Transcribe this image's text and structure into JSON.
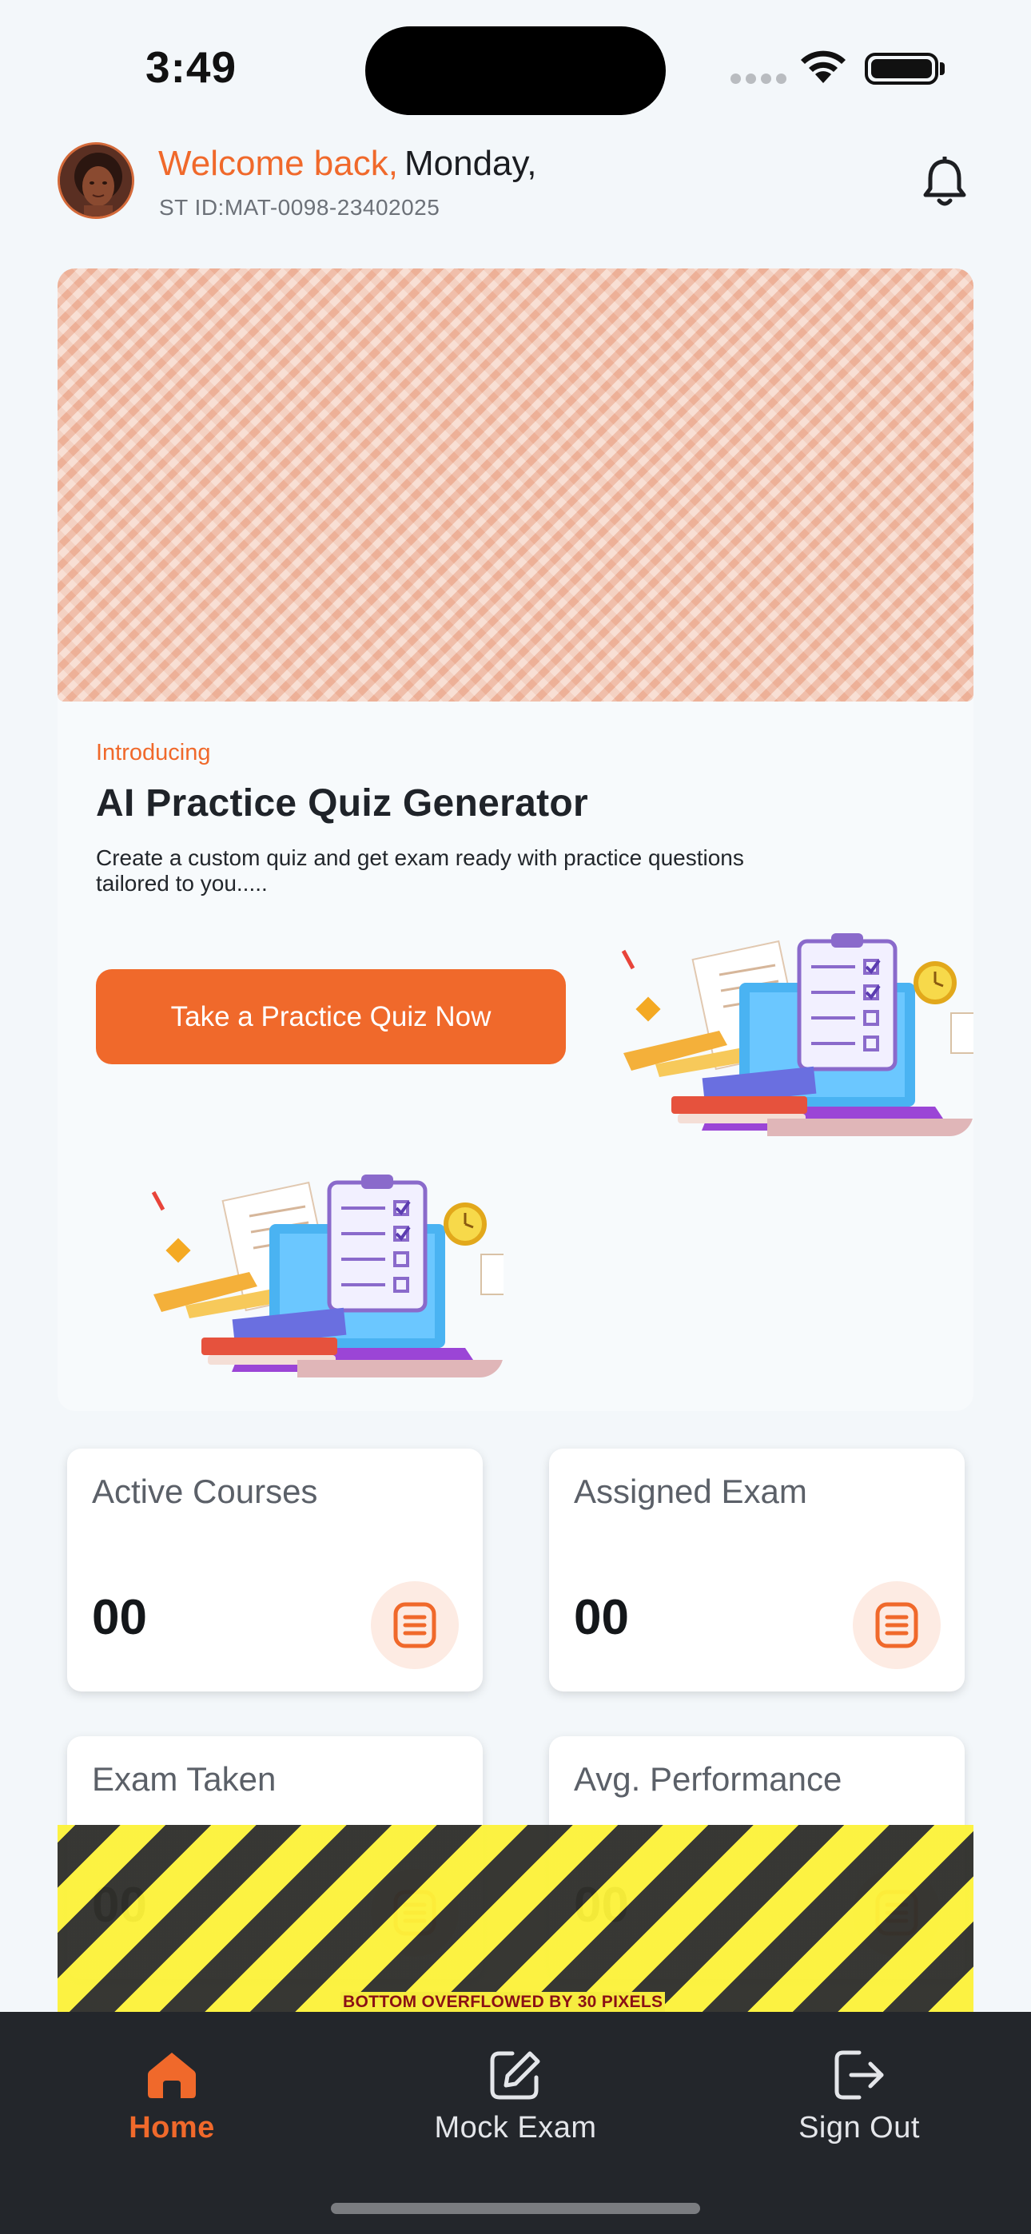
{
  "status_bar": {
    "time": "3:49"
  },
  "header": {
    "welcome": "Welcome back,",
    "day": "Monday,",
    "student_id": "ST ID:MAT-0098-23402025"
  },
  "banner": {
    "intro": "Introducing",
    "title": "AI Practice Quiz Generator",
    "description": "Create a custom quiz and get exam ready with practice questions tailored to you.....",
    "cta_label": "Take a Practice Quiz Now"
  },
  "stats": [
    {
      "label": "Active Courses",
      "value": "00"
    },
    {
      "label": "Assigned Exam",
      "value": "00"
    },
    {
      "label": "Exam Taken",
      "value": "00"
    },
    {
      "label": "Avg. Performance",
      "value": "00"
    }
  ],
  "overflow_warning": "BOTTOM OVERFLOWED BY 30 PIXELS",
  "nav": {
    "items": [
      {
        "label": "Home",
        "icon": "home-icon",
        "active": true
      },
      {
        "label": "Mock Exam",
        "icon": "edit-icon",
        "active": false
      },
      {
        "label": "Sign Out",
        "icon": "sign-out-icon",
        "active": false
      }
    ]
  },
  "colors": {
    "accent": "#f0692b",
    "nav_background": "#23262b",
    "background": "#f3f7fa"
  }
}
